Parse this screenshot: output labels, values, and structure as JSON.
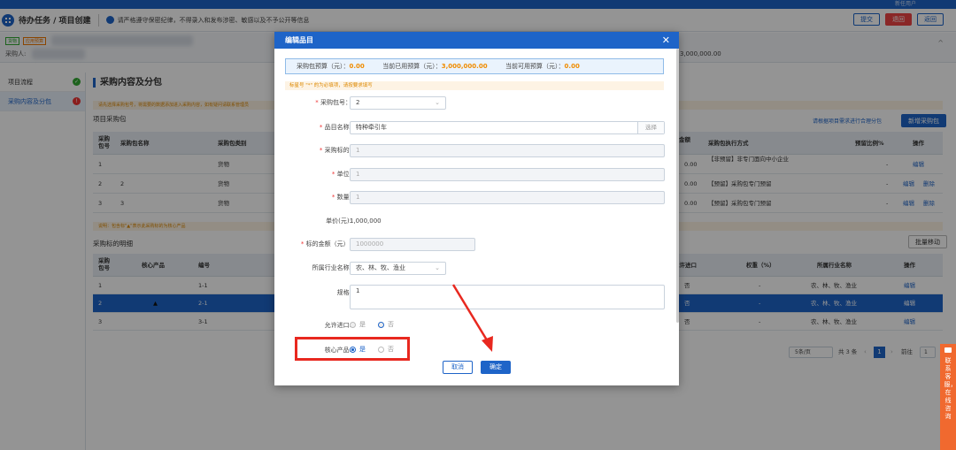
{
  "topbar": {
    "user": "新任用户"
  },
  "titlebar": {
    "breadcrumb": "待办任务 / 项目创建",
    "notice": "请严格遵守保密纪律，不得录入和发布涉密、敏感以及不予公开等信息",
    "buttons": {
      "submit": "提交",
      "back": "退回",
      "return": "返回"
    }
  },
  "info": {
    "tag1": "货物",
    "tag2": "应用预算",
    "buyer_label": "采购人:",
    "amount": "3,000,000.00"
  },
  "sidebar": {
    "items": [
      {
        "label": "项目流程",
        "status": "✓"
      },
      {
        "label": "采购内容及分包",
        "status": "!"
      }
    ]
  },
  "main": {
    "section_title": "采购内容及分包",
    "tip1": "请先选择采购包号，将需要的数据添加进入采购内容，如有疑问请联系管理员",
    "packages_label": "项目采购包",
    "packages_link": "请根据项目需求进行合理分包",
    "add_package_btn": "新增采购包",
    "pkg_headers": {
      "no": "采购包号",
      "name": "采购包名称",
      "type": "采购包类别",
      "amount": "金额",
      "method": "采购包执行方式",
      "ratio": "预留比例%",
      "op": "操作"
    },
    "packages": [
      {
        "no": "1",
        "name": "",
        "type": "货物",
        "amount": "0.00",
        "method": "【非预留】非专门面向中小企业",
        "ratio": "-",
        "op": "编辑",
        "op2": ""
      },
      {
        "no": "2",
        "name": "2",
        "type": "货物",
        "amount": "0.00",
        "method": "【预留】采购包专门预留",
        "ratio": "-",
        "op": "编辑",
        "op2": "删除"
      },
      {
        "no": "3",
        "name": "3",
        "type": "货物",
        "amount": "0.00",
        "method": "【预留】采购包专门预留",
        "ratio": "-",
        "op": "编辑",
        "op2": "删除"
      }
    ],
    "tip2": "说明：包含标\"▲\"表示此采购标的为核心产品",
    "items_label": "采购标的明细",
    "batch_move_btn": "批量移动",
    "item_headers": {
      "pkg": "采购包号",
      "core": "核心产品",
      "code": "编号",
      "import": "允许进口",
      "weight": "权重（%）",
      "industry": "所属行业名称",
      "op": "操作"
    },
    "items": [
      {
        "pkg": "1",
        "core": "",
        "code": "1-1",
        "import": "否",
        "weight": "-",
        "industry": "农、林、牧、渔业",
        "op": "编辑"
      },
      {
        "pkg": "2",
        "core": "▲",
        "code": "2-1",
        "import": "否",
        "weight": "-",
        "industry": "农、林、牧、渔业",
        "op": "编辑"
      },
      {
        "pkg": "3",
        "core": "",
        "code": "3-1",
        "import": "否",
        "weight": "-",
        "industry": "农、林、牧、渔业",
        "op": "编辑"
      }
    ],
    "pagination": {
      "page_size": "5条/页",
      "total": "共 3 条",
      "current": "1",
      "goto_label": "前往",
      "goto_value": "1"
    }
  },
  "modal": {
    "title": "编辑品目",
    "budget": {
      "label1": "采购包预算（元）：",
      "v1": "0.00",
      "label2": "当前已用预算（元）：",
      "v2": "3,000,000.00",
      "label3": "当前可用预算（元）：",
      "v3": "0.00"
    },
    "warn": "标星号 \"*\" 的为必填项，请按要求填写",
    "fields": {
      "pkg_no": {
        "label": "采购包号：",
        "value": "2"
      },
      "item_name": {
        "label": "品目名称:",
        "value": "特种牵引车",
        "choose": "选择"
      },
      "subject": {
        "label": "采购标的:",
        "value": "1"
      },
      "unit": {
        "label": "单位:",
        "value": "1"
      },
      "qty": {
        "label": "数量:",
        "value": "1"
      },
      "price": {
        "label": "单价(元):",
        "value": "1,000,000"
      },
      "total": {
        "label": "标的金额（元）:",
        "value": "1000000"
      },
      "industry": {
        "label": "所属行业名称:",
        "value": "农、林、牧、渔业"
      },
      "spec": {
        "label": "规格:",
        "value": "1"
      },
      "import": {
        "label": "允许进口:",
        "yes": "是",
        "no": "否"
      },
      "core": {
        "label": "核心产品:",
        "yes": "是",
        "no": "否"
      }
    },
    "cancel": "取消",
    "confirm": "确定"
  },
  "float_contact": "联系客服，在线咨询",
  "colors": {
    "primary": "#1e64c8",
    "danger": "#e44",
    "warn_orange": "#f08c00",
    "highlight_red": "#e8281f"
  }
}
